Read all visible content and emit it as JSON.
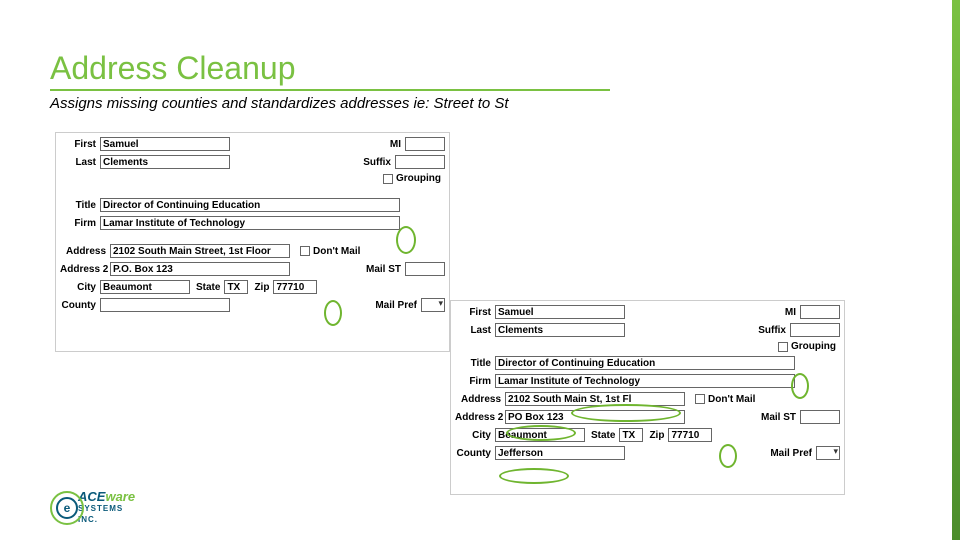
{
  "slide": {
    "title": "Address Cleanup",
    "subtitle": "Assigns missing counties and standardizes addresses ie: Street to St"
  },
  "labels": {
    "first": "First",
    "mi": "MI",
    "last": "Last",
    "suffix": "Suffix",
    "grouping": "Grouping",
    "title": "Title",
    "firm": "Firm",
    "address": "Address",
    "address2": "Address 2",
    "dont_mail": "Don't Mail",
    "mail_st": "Mail ST",
    "city": "City",
    "state": "State",
    "zip": "Zip",
    "county": "County",
    "mail_pref": "Mail Pref"
  },
  "form_before": {
    "first": "Samuel",
    "mi": "",
    "last": "Clements",
    "suffix": "",
    "title_val": "Director of Continuing Education",
    "firm": "Lamar Institute of Technology",
    "address": "2102 South Main Street, 1st Floor",
    "address2": "P.O. Box 123",
    "city": "Beaumont",
    "state": "TX",
    "zip": "77710",
    "county": "",
    "mail_st": ""
  },
  "form_after": {
    "first": "Samuel",
    "mi": "",
    "last": "Clements",
    "suffix": "",
    "title_val": "Director of Continuing Education",
    "firm": "Lamar Institute of Technology",
    "address": "2102 South Main St, 1st Fl",
    "address2": "PO Box 123",
    "city": "Beaumont",
    "state": "TX",
    "zip": "77710",
    "county": "Jefferson",
    "mail_st": ""
  },
  "logo": {
    "badge": "e",
    "line1a": "ACE",
    "line1b": "ware",
    "line2": "SYSTEMS",
    "line3": "INC."
  }
}
